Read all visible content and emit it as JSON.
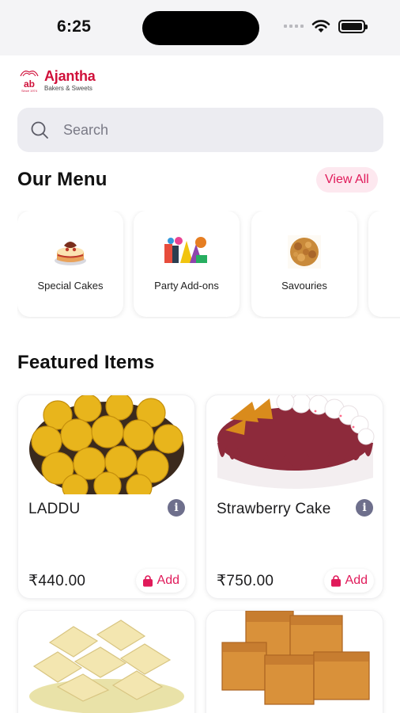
{
  "status_bar": {
    "time": "6:25",
    "icons": [
      "signal-icon",
      "wifi-icon",
      "battery-icon"
    ]
  },
  "brand": {
    "name": "Ajantha",
    "tagline": "Bakers & Sweets",
    "mark": "ab",
    "mark_sub": "Since 1974",
    "color": "#d0103a"
  },
  "search": {
    "placeholder": "Search",
    "value": ""
  },
  "menu": {
    "title": "Our Menu",
    "view_all": "View All",
    "categories": [
      {
        "label": "Special Cakes",
        "icon": "cake-image"
      },
      {
        "label": "Party Add-ons",
        "icon": "party-image"
      },
      {
        "label": "Savouries",
        "icon": "savouries-image"
      }
    ]
  },
  "featured": {
    "title": "Featured Items",
    "items": [
      {
        "name": "LADDU",
        "price": "₹440.00",
        "add_label": "Add",
        "image": "laddu-image"
      },
      {
        "name": "Strawberry Cake",
        "price": "₹750.00",
        "add_label": "Add",
        "image": "strawberry-cake-image"
      },
      {
        "name": "",
        "price": "",
        "add_label": "",
        "image": "kaju-katli-image"
      },
      {
        "name": "",
        "price": "",
        "add_label": "",
        "image": "mysore-pak-image"
      }
    ]
  },
  "colors": {
    "accent": "#e01a5a",
    "accent_bg": "#fde8ef",
    "search_bg": "#ececf1",
    "info_icon": "#6e6f8c"
  }
}
